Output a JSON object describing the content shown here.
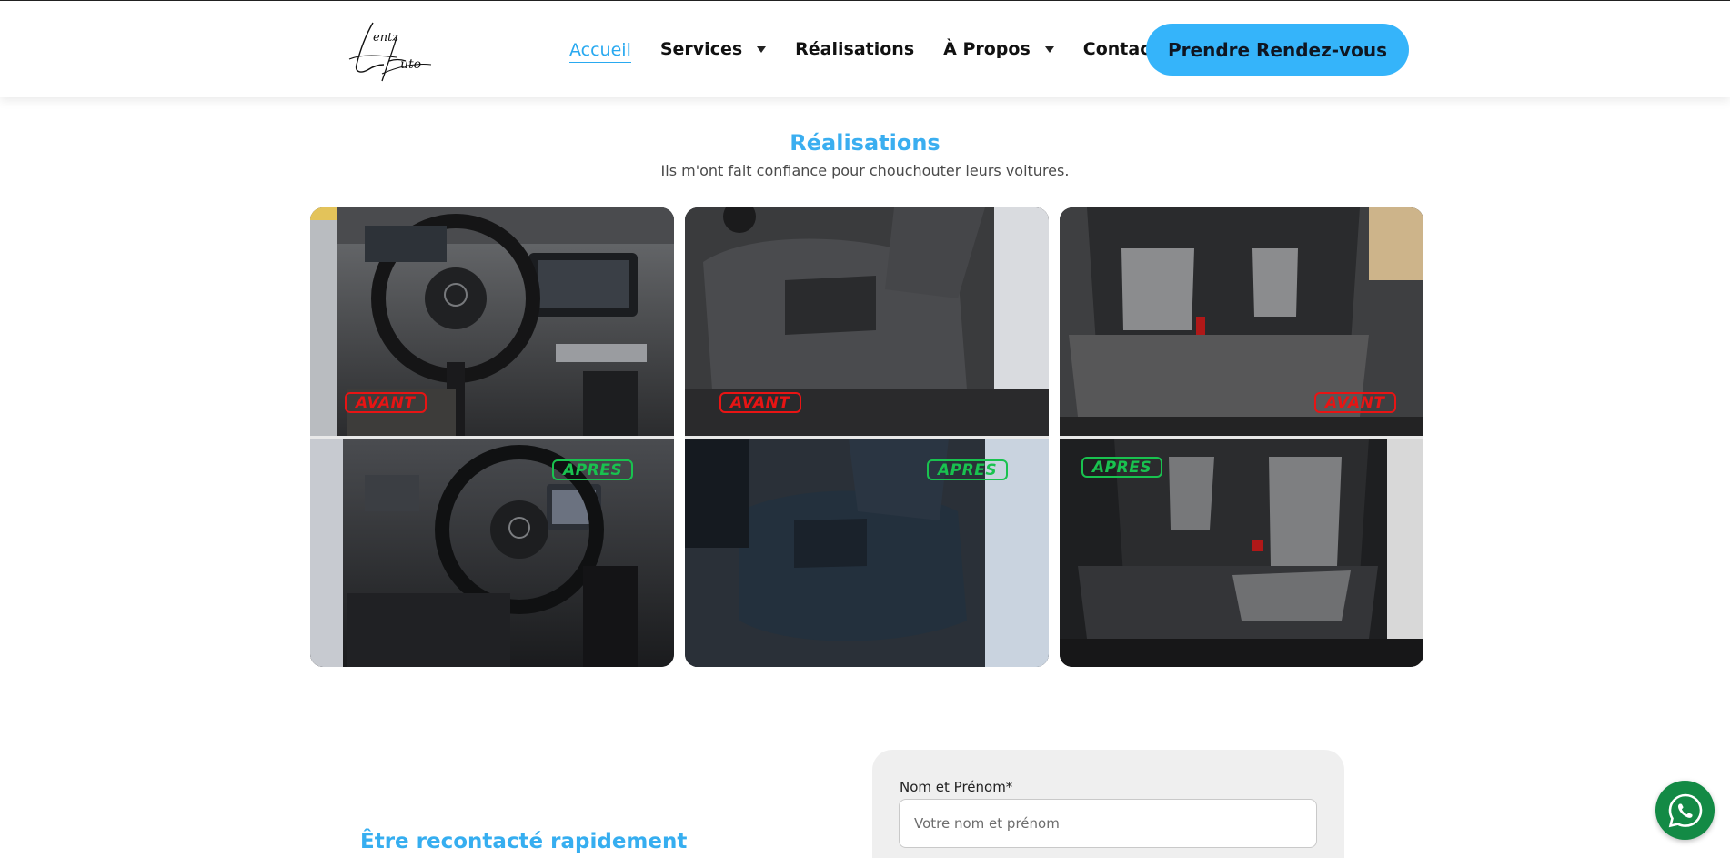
{
  "header": {
    "logo_text": "Lentz Auto",
    "nav": [
      {
        "label": "Accueil",
        "active": true,
        "dropdown": false
      },
      {
        "label": "Services",
        "active": false,
        "dropdown": true
      },
      {
        "label": "Réalisations",
        "active": false,
        "dropdown": false
      },
      {
        "label": "À Propos",
        "active": false,
        "dropdown": true
      },
      {
        "label": "Contact",
        "active": false,
        "dropdown": false
      }
    ],
    "cta_label": "Prendre Rendez-vous"
  },
  "realisations": {
    "title": "Réalisations",
    "subtitle": "Ils m'ont fait confiance pour chouchouter leurs voitures.",
    "items": [
      {
        "subject": "dashboard-steering-wheel",
        "before_label": "AVANT",
        "after_label": "APRES"
      },
      {
        "subject": "front-seat",
        "before_label": "AVANT",
        "after_label": "APRES"
      },
      {
        "subject": "rear-bench-seat",
        "before_label": "AVANT",
        "after_label": "APRES"
      }
    ]
  },
  "contact": {
    "title": "Être recontacté rapidement",
    "name_label": "Nom et Prénom*",
    "name_placeholder": "Votre nom et prénom",
    "name_value": ""
  },
  "colors": {
    "accent": "#35b4fa",
    "title_blue": "#3aaef0",
    "avant_red": "#e81414",
    "apres_green": "#19c24f",
    "whatsapp_green": "#138a45"
  },
  "icons": {
    "whatsapp": "whatsapp-icon",
    "caret": "caret-down-icon"
  }
}
